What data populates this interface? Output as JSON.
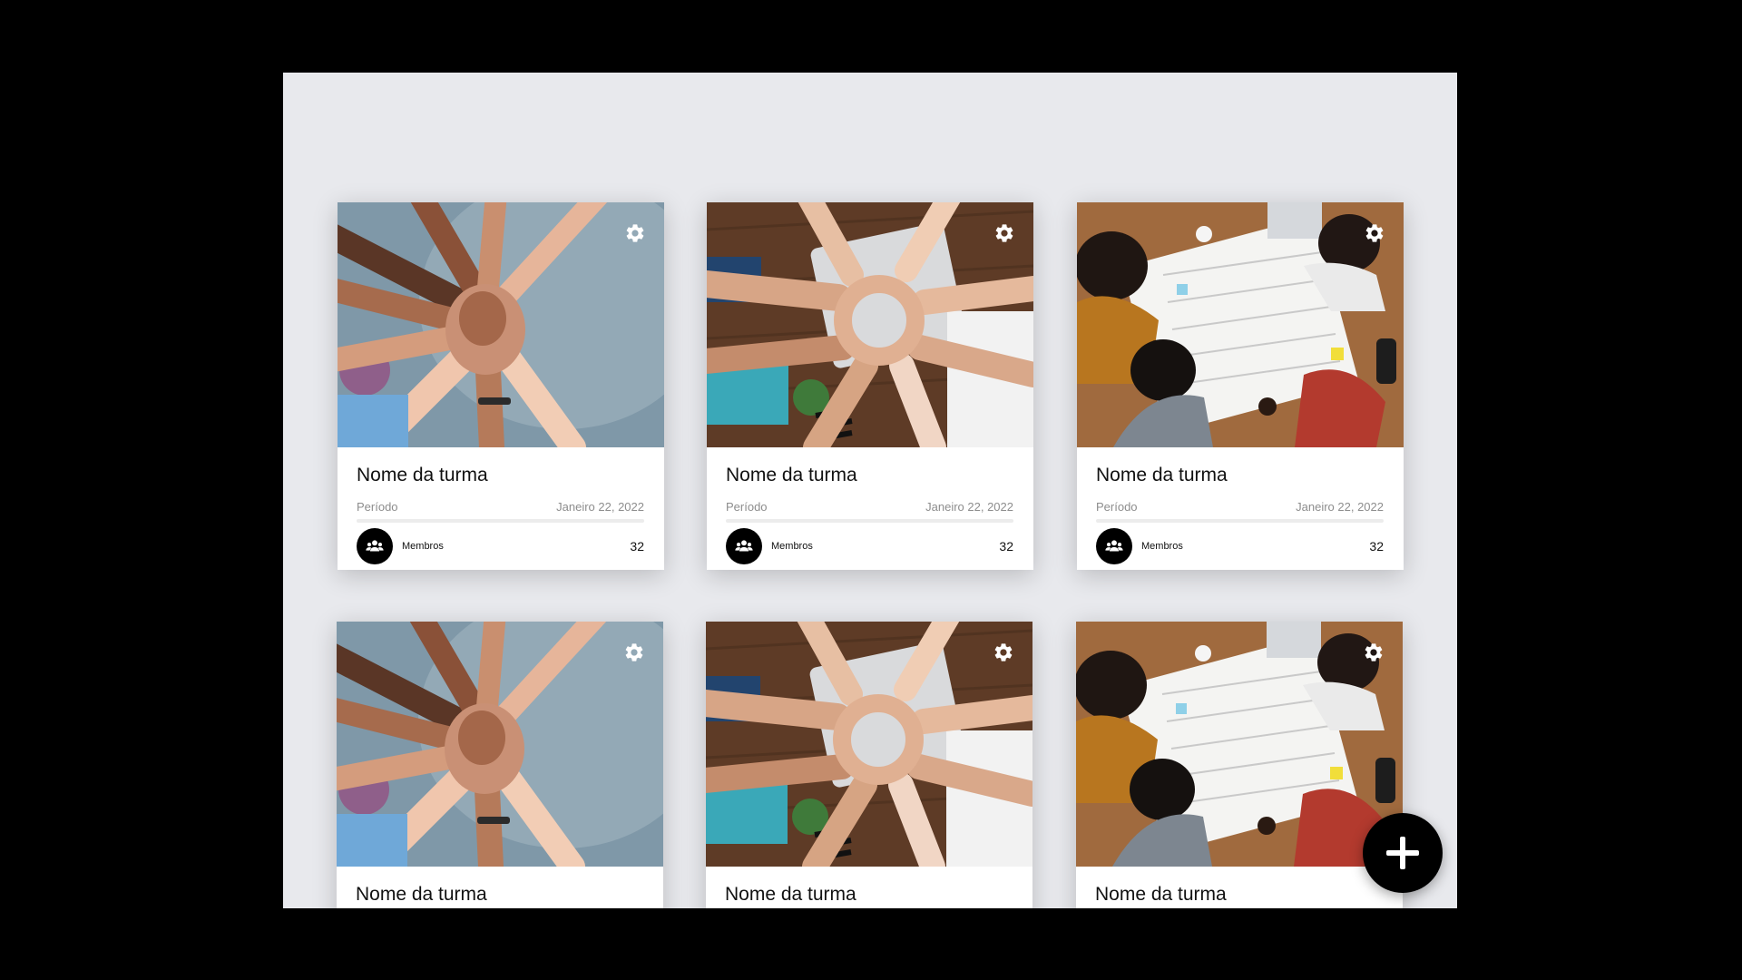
{
  "cards": [
    {
      "title": "Nome da turma",
      "period_label": "Período",
      "date": "Janeiro 22, 2022",
      "members_label": "Membros",
      "members_count": "32",
      "photo": "hands-stacked-photo"
    },
    {
      "title": "Nome da turma",
      "period_label": "Período",
      "date": "Janeiro 22, 2022",
      "members_label": "Membros",
      "members_count": "32",
      "photo": "fist-circle-photo"
    },
    {
      "title": "Nome da turma",
      "period_label": "Período",
      "date": "Janeiro 22, 2022",
      "members_label": "Membros",
      "members_count": "32",
      "photo": "team-meeting-photo"
    },
    {
      "title": "Nome da turma",
      "photo": "hands-stacked-photo"
    },
    {
      "title": "Nome da turma",
      "photo": "fist-circle-photo"
    },
    {
      "title": "Nome da turma",
      "photo": "team-meeting-photo"
    }
  ],
  "icons": {
    "settings": "gear-icon",
    "members": "group-icon",
    "add": "plus-icon"
  },
  "colors": {
    "page_background": "#000000",
    "panel_background": "#e8e9ed",
    "card_background": "#ffffff",
    "accent": "#000000"
  }
}
